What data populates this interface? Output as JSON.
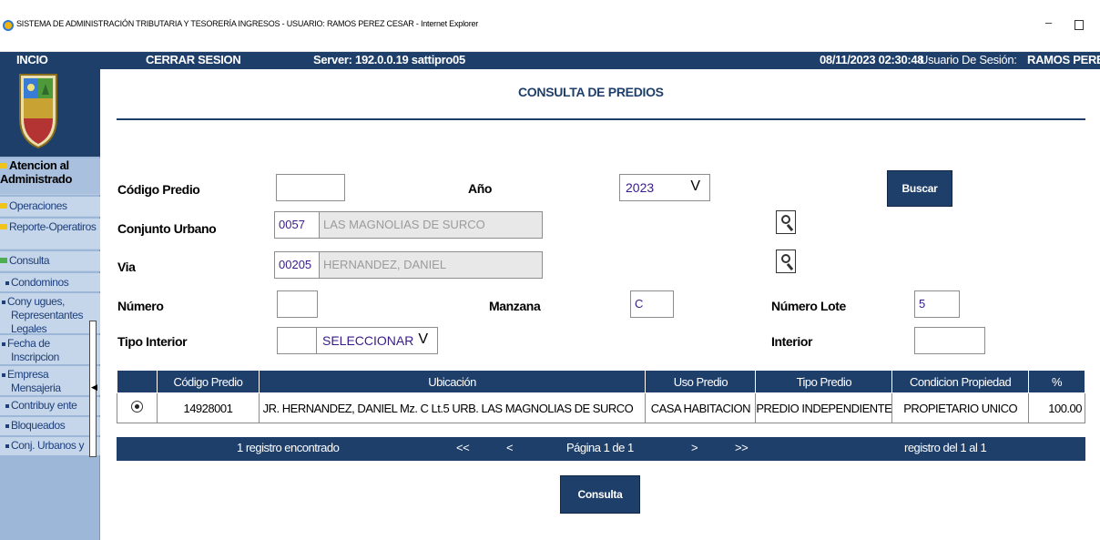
{
  "window": {
    "title": "SISTEMA DE ADMINISTRACIÓN TRIBUTARIA Y TESORERÍA INGRESOS - USUARIO: RAMOS PEREZ CESAR - Internet Explorer",
    "minimize": "–"
  },
  "topnav": {
    "inicio": "INCIO",
    "cerrar": "CERRAR SESION",
    "server": "Server:  192.0.0.19  sattipro05",
    "fecha": "08/11/2023 02:30:48",
    "usuario_label": "Usuario De Sesión:",
    "usuario_name": "RAMOS PEREZ CESAR"
  },
  "sidebar": {
    "items": [
      {
        "label": "Atencion al Administrado",
        "bullet": "yellow"
      },
      {
        "label": "Operaciones",
        "bullet": "yellow"
      },
      {
        "label": "Reporte-Operatiros",
        "bullet": "yellow"
      },
      {
        "label": "Consulta",
        "bullet": "green"
      },
      {
        "label": "Condominos",
        "bullet": "dot"
      },
      {
        "label": "Cony ugues, Representantes Legales",
        "bullet": "dot"
      },
      {
        "label": "Fecha de Inscripcion",
        "bullet": "dot"
      },
      {
        "label": "Empresa Mensajeria",
        "bullet": "dot"
      },
      {
        "label": "Contribuy ente",
        "bullet": "dot"
      },
      {
        "label": "Bloqueados",
        "bullet": "dot"
      },
      {
        "label": "Conj. Urbanos y",
        "bullet": "dot"
      }
    ]
  },
  "page": {
    "title": "CONSULTA DE PREDIOS"
  },
  "form": {
    "codigo_predio_label": "Código Predio",
    "codigo_predio_value": "",
    "anio_label": "Año",
    "anio_value": "2023",
    "buscar_label": "Buscar",
    "conjunto_label": "Conjunto Urbano",
    "conjunto_code": "0057",
    "conjunto_name": "LAS MAGNOLIAS DE SURCO",
    "via_label": "Via",
    "via_code": "00205",
    "via_name": "HERNANDEZ, DANIEL",
    "numero_label": "Número",
    "numero_value": "",
    "manzana_label": "Manzana",
    "manzana_value": "C",
    "lote_label": "Número Lote",
    "lote_value": "5",
    "tipo_interior_label": "Tipo Interior",
    "tipo_interior_code": "",
    "tipo_interior_value": "SELECCIONAR",
    "interior_label": "Interior",
    "interior_value": ""
  },
  "table": {
    "headers": [
      "",
      "Código Predio",
      "Ubicación",
      "Uso Predio",
      "Tipo Predio",
      "Condicion Propiedad",
      "%"
    ],
    "rows": [
      {
        "codigo": "14928001",
        "ubicacion": "JR. HERNANDEZ, DANIEL Mz. C Lt.5 URB. LAS MAGNOLIAS DE SURCO",
        "uso": "CASA HABITACION",
        "tipo": "PREDIO INDEPENDIENTE",
        "condicion": "PROPIETARIO UNICO",
        "porcentaje": "100.00",
        "selected": true
      }
    ],
    "pager": {
      "encontrados": "1 registro encontrado",
      "first": "<<",
      "prev": "<",
      "pagina": "Página 1 de 1",
      "next": ">",
      "last": ">>",
      "rango": "registro del 1 al 1"
    }
  },
  "consulta_button": "Consulta",
  "colors": {
    "primary": "#1f3f6b",
    "sidebar": "#9db7d8",
    "value_text": "#3a1a8a"
  }
}
